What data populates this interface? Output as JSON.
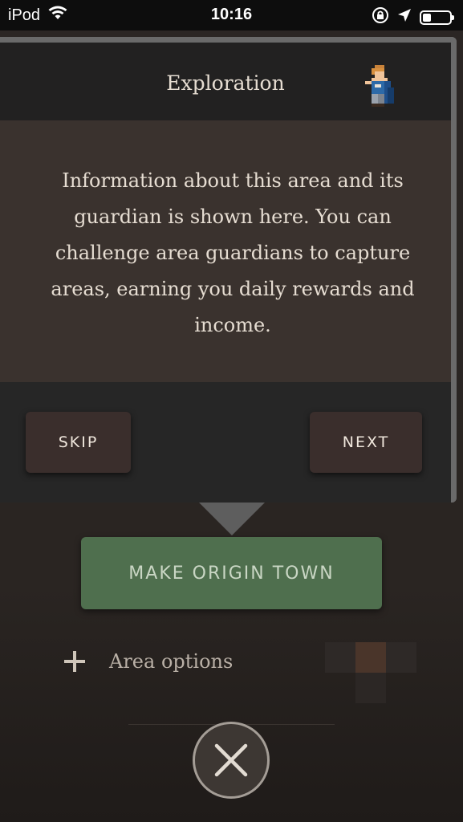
{
  "status_bar": {
    "carrier": "iPod",
    "time": "10:16"
  },
  "dialog": {
    "title": "Exploration",
    "icon": "hero-sprite-icon",
    "message": "Information about this area and its guardian is shown here. You can challenge area guardians to capture areas, earning you daily rewards and income.",
    "skip_label": "SKIP",
    "next_label": "NEXT"
  },
  "main": {
    "origin_button_label": "MAKE ORIGIN TOWN",
    "area_options_label": "Area options"
  },
  "colors": {
    "origin_button": "#4f6f4e",
    "dialog_body": "#3a322e",
    "tile_accent": "#4a352a"
  },
  "icons": [
    "wifi-icon",
    "lock-rotation-icon",
    "location-arrow-icon",
    "battery-icon",
    "hero-sprite-icon",
    "plus-icon",
    "close-icon"
  ]
}
